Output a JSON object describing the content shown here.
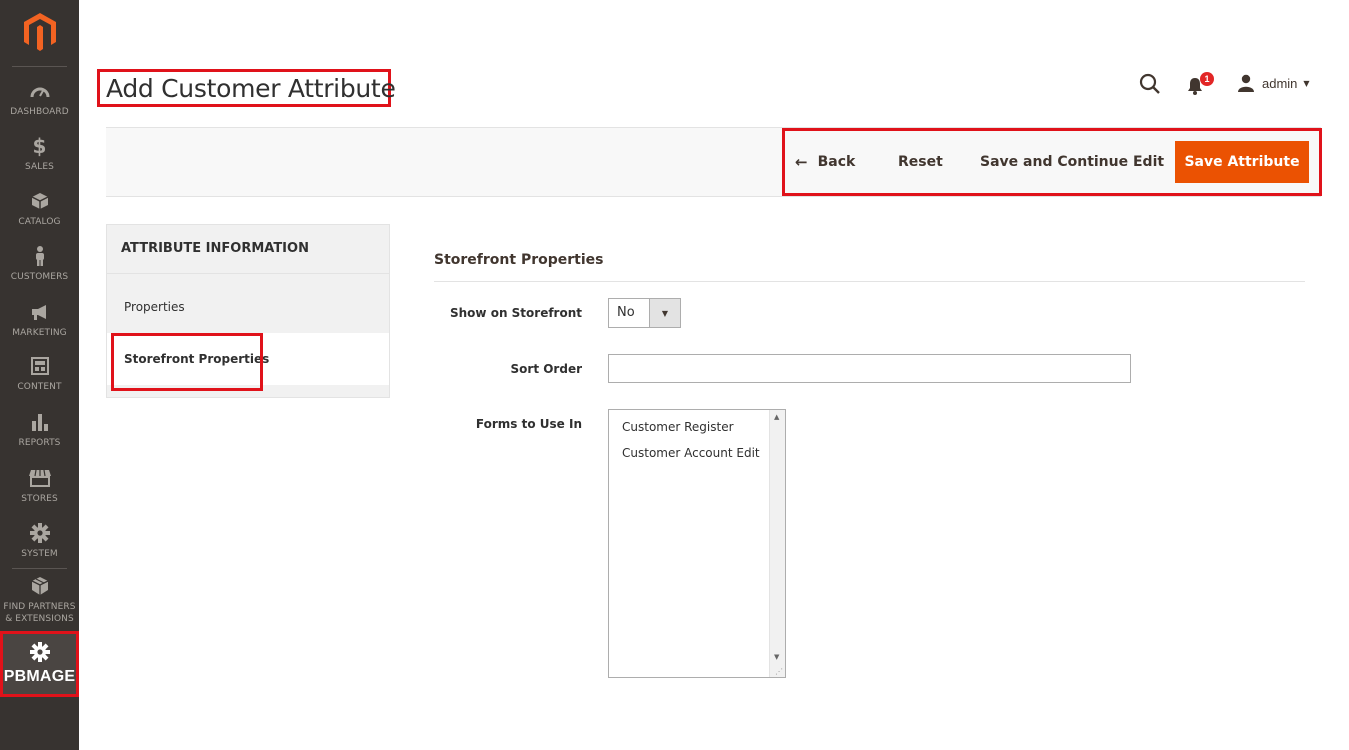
{
  "sidebar": {
    "logo_icon": "magento-logo-icon",
    "items": [
      {
        "label": "DASHBOARD",
        "icon": "dashboard-icon"
      },
      {
        "label": "SALES",
        "icon": "dollar-icon"
      },
      {
        "label": "CATALOG",
        "icon": "box-icon"
      },
      {
        "label": "CUSTOMERS",
        "icon": "person-icon"
      },
      {
        "label": "MARKETING",
        "icon": "megaphone-icon"
      },
      {
        "label": "CONTENT",
        "icon": "content-icon"
      },
      {
        "label": "REPORTS",
        "icon": "bar-chart-icon"
      },
      {
        "label": "STORES",
        "icon": "store-icon"
      },
      {
        "label": "SYSTEM",
        "icon": "gear-icon"
      },
      {
        "label": "FIND PARTNERS & EXTENSIONS",
        "label_line1": "FIND PARTNERS",
        "label_line2": "& EXTENSIONS",
        "icon": "cubes-icon"
      }
    ],
    "pbmage": {
      "label": "PBMAGE",
      "icon": "gear-icon"
    }
  },
  "header": {
    "title": "Add Customer Attribute",
    "notifications_count": "1",
    "user_name": "admin"
  },
  "actions": {
    "back": "Back",
    "reset": "Reset",
    "save_continue": "Save and Continue Edit",
    "save": "Save Attribute"
  },
  "tabs": {
    "title": "ATTRIBUTE INFORMATION",
    "items": [
      "Properties",
      "Storefront Properties"
    ],
    "active": "Storefront Properties"
  },
  "form": {
    "section_title": "Storefront Properties",
    "show_on_storefront": {
      "label": "Show on Storefront",
      "value": "No"
    },
    "sort_order": {
      "label": "Sort Order",
      "value": ""
    },
    "forms_to_use": {
      "label": "Forms to Use In",
      "options": [
        "Customer Register",
        "Customer Account Edit"
      ]
    }
  },
  "colors": {
    "sidebar_bg": "#373330",
    "accent": "#eb5202",
    "highlight": "#e0121a"
  }
}
